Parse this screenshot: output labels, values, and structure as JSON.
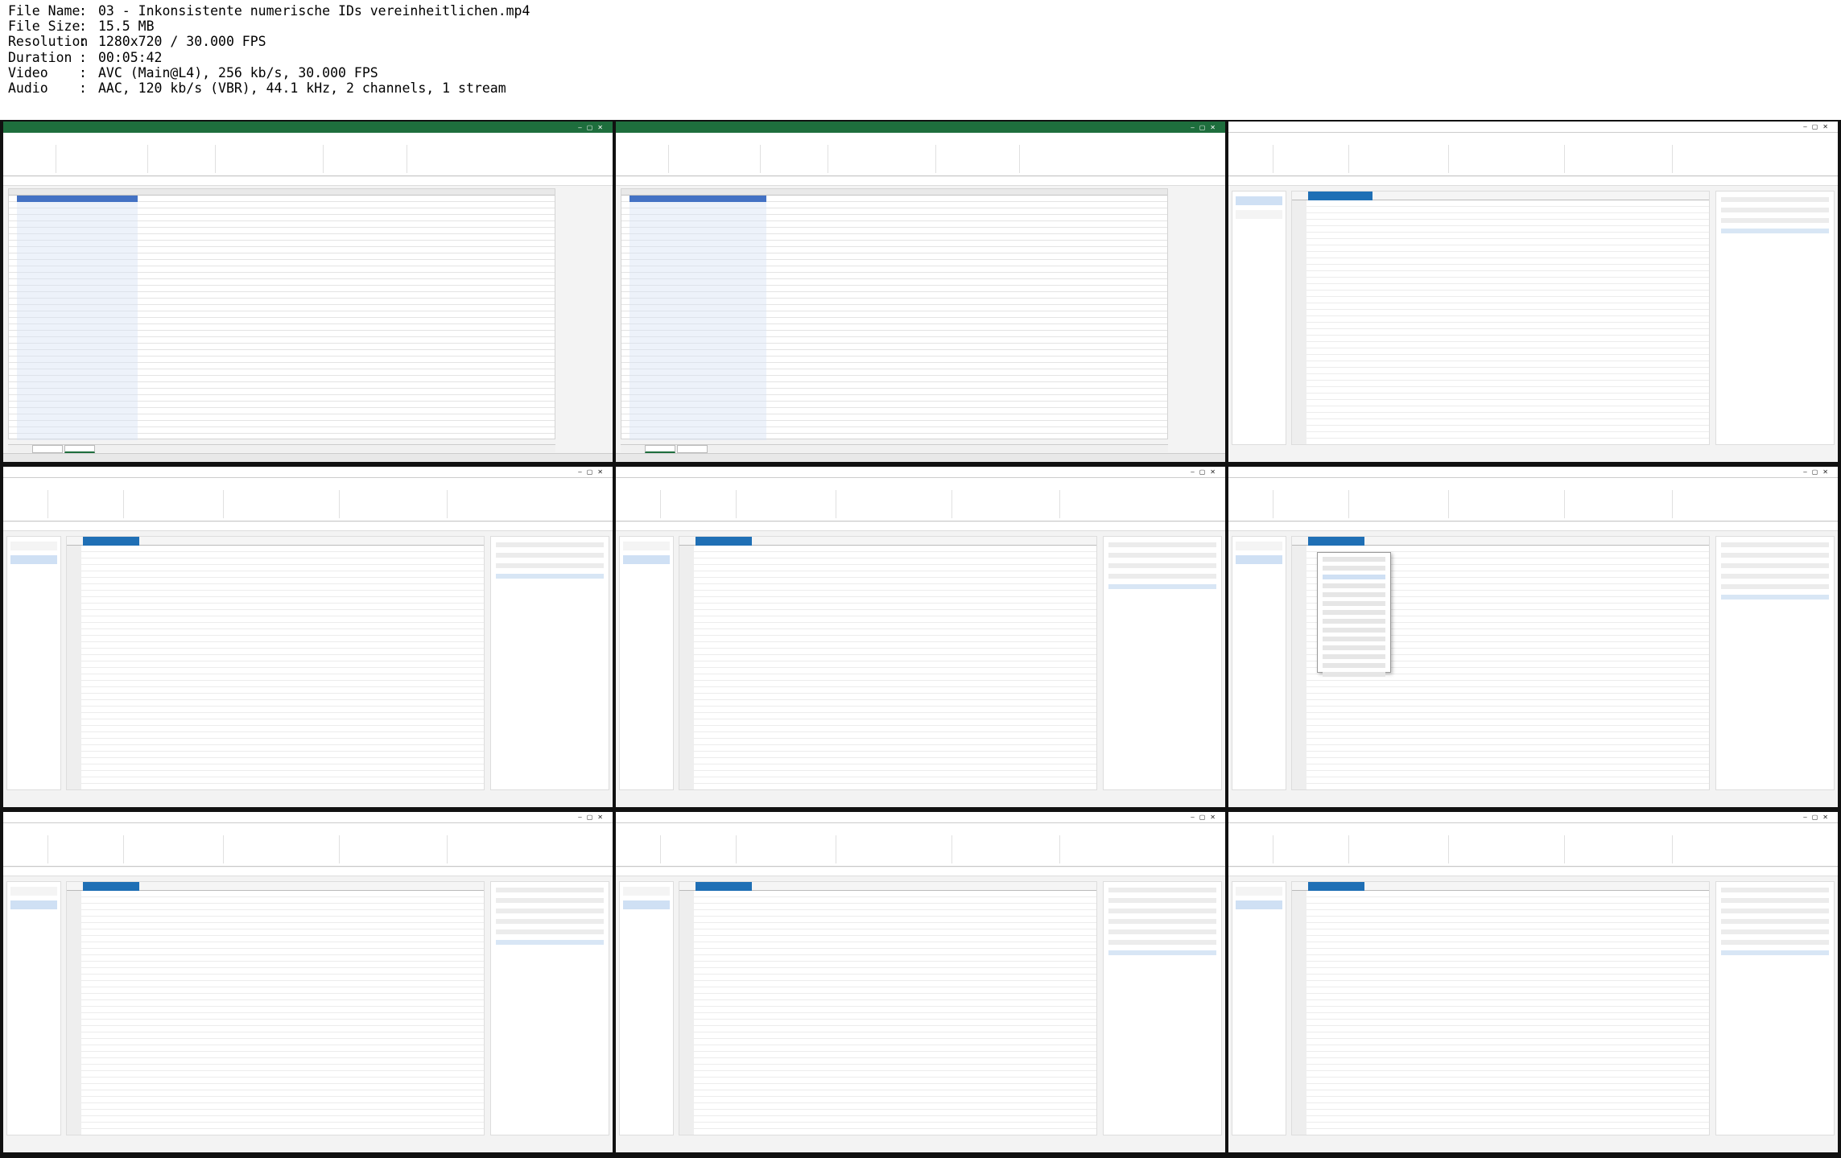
{
  "header": {
    "file_name": {
      "label": "File Name",
      "value": "03 - Inkonsistente numerische IDs vereinheitlichen.mp4"
    },
    "file_size": {
      "label": "File Size",
      "value": "15.5 MB"
    },
    "resolution": {
      "label": "Resolution",
      "value": "1280x720 / 30.000 FPS"
    },
    "duration": {
      "label": "Duration",
      "value": "00:05:42"
    },
    "video": {
      "label": "Video",
      "value": "AVC (Main@L4), 256 kb/s, 30.000 FPS"
    },
    "audio": {
      "label": "Audio",
      "value": "AAC, 120 kb/s (VBR), 44.1 kHz, 2 channels, 1 stream"
    }
  },
  "colors": {
    "excel_green": "#1e6e3d",
    "pq_blue": "#1f6fb5",
    "table_header": "#4472c4"
  }
}
